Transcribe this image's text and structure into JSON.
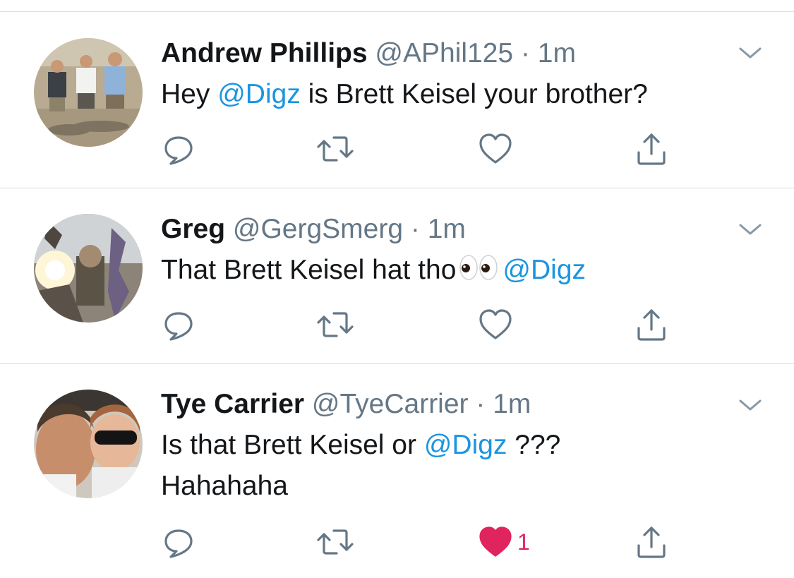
{
  "tweets": [
    {
      "display_name": "Andrew Phillips",
      "handle": "@APhil125",
      "separator": "·",
      "time": "1m",
      "text_parts": [
        "Hey ",
        "@Digz",
        " is Brett Keisel your brother?"
      ],
      "liked": false,
      "like_count": ""
    },
    {
      "display_name": "Greg",
      "handle": "@GergSmerg",
      "separator": "·",
      "time": "1m",
      "text_parts": [
        "That Brett Keisel hat tho",
        "@Digz"
      ],
      "emoji": "eyes",
      "liked": false,
      "like_count": ""
    },
    {
      "display_name": "Tye Carrier",
      "handle": "@TyeCarrier",
      "separator": "·",
      "time": "1m",
      "text_parts": [
        "Is that Brett Keisel or ",
        "@Digz",
        " ???",
        "Hahahaha"
      ],
      "liked": true,
      "like_count": "1"
    }
  ],
  "icons": {
    "reply": "speech-bubble-icon",
    "retweet": "retweet-arrows-icon",
    "like": "heart-icon",
    "share": "share-upload-icon",
    "more": "chevron-down-icon"
  },
  "colors": {
    "text": "#14171a",
    "secondary": "#657786",
    "link": "#1b95e0",
    "like_active": "#e0245e",
    "divider": "#d9dde1"
  }
}
